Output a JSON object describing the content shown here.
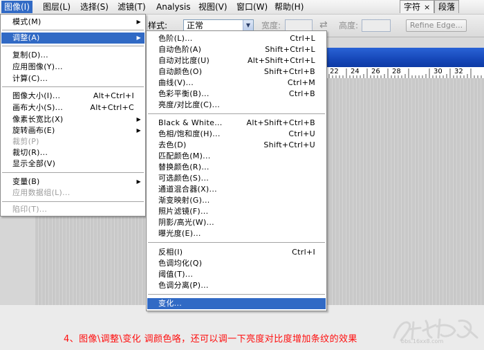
{
  "menubar": {
    "items": [
      {
        "label": "图像(I)",
        "active": true
      },
      {
        "label": "图层(L)"
      },
      {
        "label": "选择(S)"
      },
      {
        "label": "滤镜(T)"
      },
      {
        "label": "Analysis"
      },
      {
        "label": "视图(V)"
      },
      {
        "label": "窗口(W)"
      },
      {
        "label": "帮助(H)"
      }
    ]
  },
  "panel_tabs": [
    {
      "label": "字符",
      "close": "×"
    },
    {
      "label": "段落"
    }
  ],
  "options_bar": {
    "style_label": "样式:",
    "style_value": "正常",
    "width_label": "宽度:",
    "swap_icon": "⇄",
    "height_label": "高度:",
    "refine_edge": "Refine Edge..."
  },
  "ruler": {
    "numbers": [
      "22",
      "24",
      "26",
      "28",
      "30",
      "32"
    ]
  },
  "image_menu": {
    "items": [
      {
        "label": "模式(M)",
        "submenu": true
      },
      {
        "label": "调整(A)",
        "submenu": true,
        "highlight": true
      },
      {
        "label": "复制(D)..."
      },
      {
        "label": "应用图像(Y)..."
      },
      {
        "label": "计算(C)..."
      },
      {
        "label": "图像大小(I)...",
        "shortcut": "Alt+Ctrl+I"
      },
      {
        "label": "画布大小(S)...",
        "shortcut": "Alt+Ctrl+C"
      },
      {
        "label": "像素长宽比(X)",
        "submenu": true
      },
      {
        "label": "旋转画布(E)",
        "submenu": true
      },
      {
        "label": "裁剪(P)",
        "disabled": true
      },
      {
        "label": "裁切(R)..."
      },
      {
        "label": "显示全部(V)"
      },
      {
        "label": "变量(B)",
        "submenu": true
      },
      {
        "label": "应用数据组(L)...",
        "disabled": true
      },
      {
        "label": "陷印(T)...",
        "disabled": true
      }
    ]
  },
  "adjust_menu": {
    "items": [
      {
        "label": "色阶(L)...",
        "shortcut": "Ctrl+L"
      },
      {
        "label": "自动色阶(A)",
        "shortcut": "Shift+Ctrl+L"
      },
      {
        "label": "自动对比度(U)",
        "shortcut": "Alt+Shift+Ctrl+L"
      },
      {
        "label": "自动颜色(O)",
        "shortcut": "Shift+Ctrl+B"
      },
      {
        "label": "曲线(V)...",
        "shortcut": "Ctrl+M"
      },
      {
        "label": "色彩平衡(B)...",
        "shortcut": "Ctrl+B"
      },
      {
        "label": "亮度/对比度(C)..."
      },
      {
        "label": "Black & White...",
        "shortcut": "Alt+Shift+Ctrl+B"
      },
      {
        "label": "色相/饱和度(H)...",
        "shortcut": "Ctrl+U"
      },
      {
        "label": "去色(D)",
        "shortcut": "Shift+Ctrl+U"
      },
      {
        "label": "匹配颜色(M)..."
      },
      {
        "label": "替换颜色(R)..."
      },
      {
        "label": "可选颜色(S)..."
      },
      {
        "label": "通道混合器(X)..."
      },
      {
        "label": "渐变映射(G)..."
      },
      {
        "label": "照片滤镜(F)..."
      },
      {
        "label": "阴影/高光(W)..."
      },
      {
        "label": "曝光度(E)..."
      },
      {
        "label": "反相(I)",
        "shortcut": "Ctrl+I"
      },
      {
        "label": "色调均化(Q)"
      },
      {
        "label": "阈值(T)..."
      },
      {
        "label": "色调分离(P)..."
      },
      {
        "label": "变化...",
        "highlight": true
      }
    ]
  },
  "caption": "4、图像\\调整\\变化 调颜色咯，还可以调一下亮度对比度增加条纹的效果",
  "watermark_text": "bbs.16xx8.com"
}
